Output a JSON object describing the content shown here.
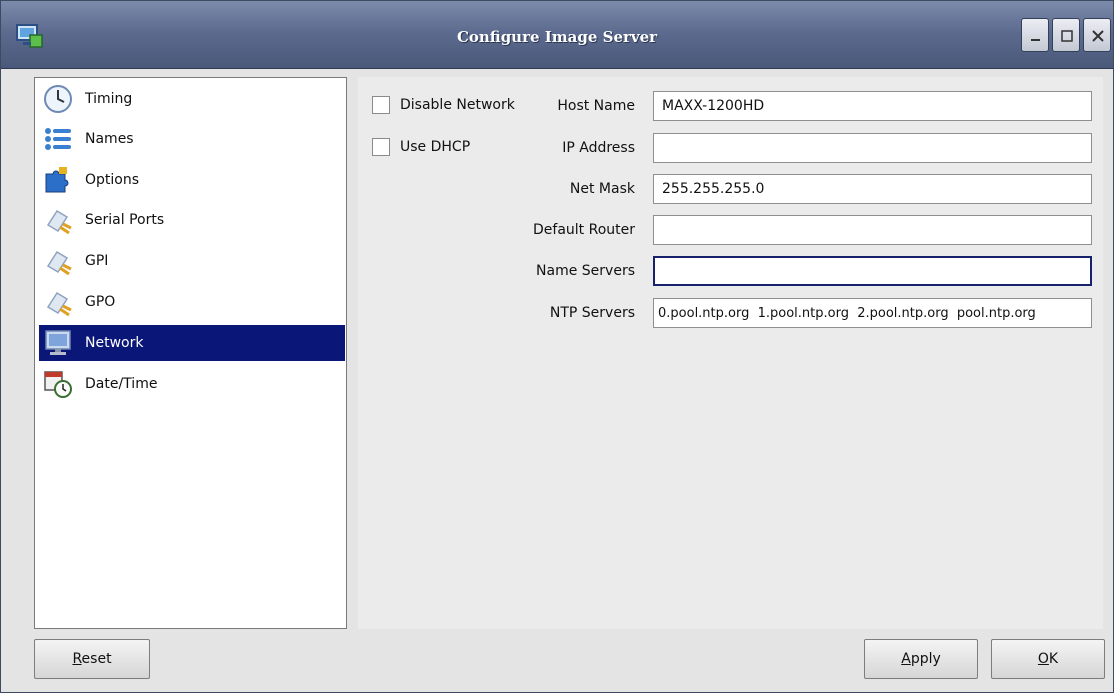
{
  "window": {
    "title": "Configure Image Server"
  },
  "sidebar": {
    "items": [
      {
        "label": "Timing",
        "icon": "clock-icon"
      },
      {
        "label": "Names",
        "icon": "list-icon"
      },
      {
        "label": "Options",
        "icon": "puzzle-icon"
      },
      {
        "label": "Serial Ports",
        "icon": "plug-icon"
      },
      {
        "label": "GPI",
        "icon": "plug-icon"
      },
      {
        "label": "GPO",
        "icon": "plug-icon"
      },
      {
        "label": "Network",
        "icon": "monitor-icon",
        "selected": true
      },
      {
        "label": "Date/Time",
        "icon": "calendar-clock-icon"
      }
    ]
  },
  "network": {
    "disable_network": {
      "label": "Disable Network",
      "checked": false
    },
    "use_dhcp": {
      "label": "Use DHCP",
      "checked": false
    },
    "host_name": {
      "label": "Host Name",
      "value": "MAXX-1200HD"
    },
    "ip_address": {
      "label": "IP Address",
      "value": ""
    },
    "net_mask": {
      "label": "Net Mask",
      "value": "255.255.255.0"
    },
    "default_router": {
      "label": "Default Router",
      "value": ""
    },
    "name_servers": {
      "label": "Name Servers",
      "value": ""
    },
    "ntp_servers": {
      "label": "NTP Servers",
      "value": "0.pool.ntp.org  1.pool.ntp.org  2.pool.ntp.org  pool.ntp.org"
    }
  },
  "buttons": {
    "reset": {
      "mnemonic": "R",
      "rest": "eset"
    },
    "apply": {
      "mnemonic": "A",
      "rest": "pply"
    },
    "ok": {
      "mnemonic": "O",
      "rest": "K"
    }
  },
  "colors": {
    "selection": "#0a1778",
    "focus_border": "#17226d",
    "titlebar": "#5c6b8f"
  }
}
